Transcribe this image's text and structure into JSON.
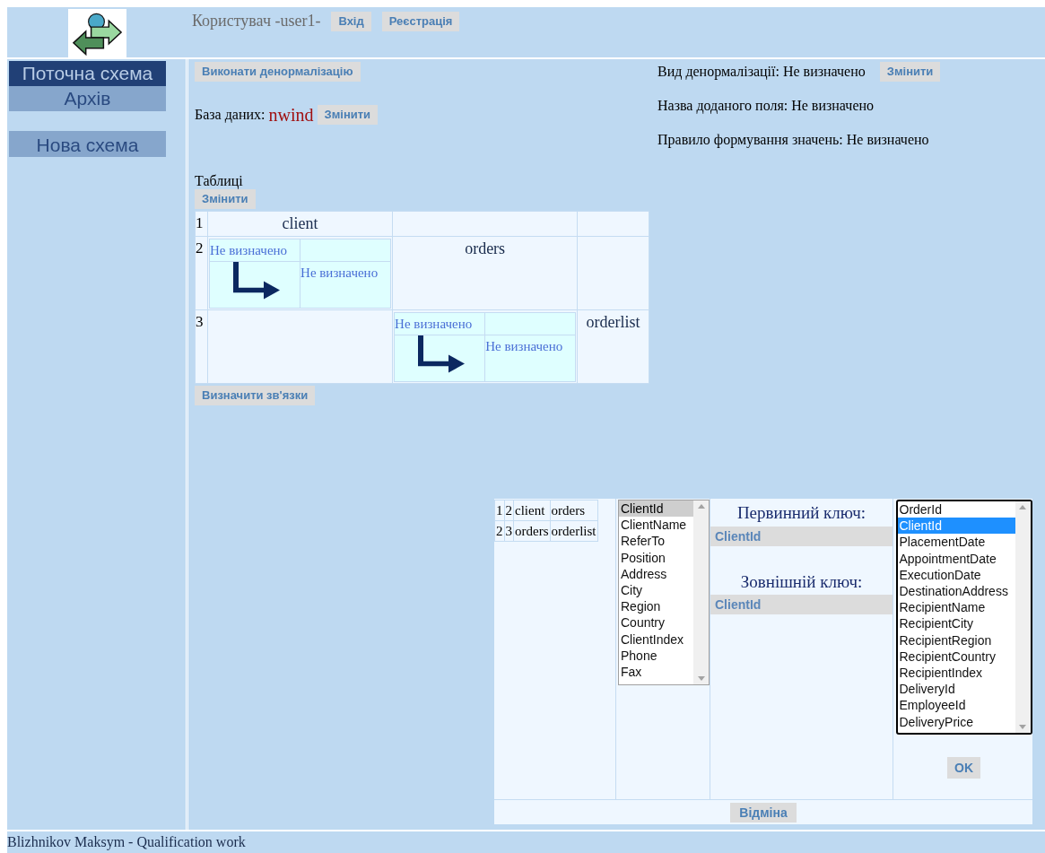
{
  "header": {
    "user_label": "Користувач -user1-",
    "buttons": [
      "Вхід",
      "Реєстрація"
    ]
  },
  "sidebar": {
    "items": [
      {
        "label": "Поточна схема",
        "selected": true
      },
      {
        "label": "Архів",
        "selected": false
      }
    ],
    "new_button": "Нова схема"
  },
  "content": {
    "denormalize_button": "Виконати денормалізацію",
    "database": {
      "label": "База даних:",
      "value": "nwind",
      "button": "Змінити"
    },
    "tables": {
      "label": "Таблиці",
      "button": "Змінити"
    },
    "grid": [
      {
        "number": "1",
        "cells": [
          {
            "kind": "table",
            "name": "client"
          },
          {
            "kind": "empty"
          },
          {
            "kind": "empty"
          }
        ]
      },
      {
        "number": "2",
        "cells": [
          {
            "kind": "link",
            "from": "Не визначено",
            "to": "Не визначено"
          },
          {
            "kind": "table",
            "name": "orders"
          },
          {
            "kind": "empty"
          }
        ]
      },
      {
        "number": "3",
        "cells": [
          {
            "kind": "empty"
          },
          {
            "kind": "link",
            "from": "Не визначено",
            "to": "Не визначено"
          },
          {
            "kind": "table",
            "name": "orderlist"
          }
        ]
      }
    ],
    "links_button": "Визначити зв'язки",
    "info": [
      {
        "text": "Вид денормалізації: Не визначено",
        "button": "Змінити"
      },
      {
        "text": "Назва доданого поля: Не визначено"
      },
      {
        "text": "Правило формування значень: Не визначено"
      }
    ]
  },
  "dialog": {
    "links": [
      [
        "1",
        "2",
        "client",
        "orders"
      ],
      [
        "2",
        "3",
        "orders",
        "orderlist"
      ]
    ],
    "left_list": {
      "focused": false,
      "items": [
        {
          "label": "ClientId",
          "selected": true
        },
        {
          "label": "ClientName",
          "selected": false
        },
        {
          "label": "ReferTo",
          "selected": false
        },
        {
          "label": "Position",
          "selected": false
        },
        {
          "label": "Address",
          "selected": false
        },
        {
          "label": "City",
          "selected": false
        },
        {
          "label": "Region",
          "selected": false
        },
        {
          "label": "Country",
          "selected": false
        },
        {
          "label": "ClientIndex",
          "selected": false
        },
        {
          "label": "Phone",
          "selected": false
        },
        {
          "label": "Fax",
          "selected": false
        }
      ]
    },
    "primary_key": {
      "label": "Первинний ключ:",
      "value": "ClientId"
    },
    "foreign_key": {
      "label": "Зовнішній ключ:",
      "value": "ClientId"
    },
    "right_list": {
      "focused": true,
      "items": [
        {
          "label": "OrderId",
          "selected": false
        },
        {
          "label": "ClientId",
          "selected": true
        },
        {
          "label": "PlacementDate",
          "selected": false
        },
        {
          "label": "AppointmentDate",
          "selected": false
        },
        {
          "label": "ExecutionDate",
          "selected": false
        },
        {
          "label": "DestinationAddress",
          "selected": false
        },
        {
          "label": "RecipientName",
          "selected": false
        },
        {
          "label": "RecipientCity",
          "selected": false
        },
        {
          "label": "RecipientRegion",
          "selected": false
        },
        {
          "label": "RecipientCountry",
          "selected": false
        },
        {
          "label": "RecipientIndex",
          "selected": false
        },
        {
          "label": "DeliveryId",
          "selected": false
        },
        {
          "label": "EmployeeId",
          "selected": false
        },
        {
          "label": "DeliveryPrice",
          "selected": false
        }
      ]
    },
    "ok_button": "OK",
    "cancel_button": "Відміна"
  },
  "footer": "Blizhnikov Maksym - Qualification work"
}
